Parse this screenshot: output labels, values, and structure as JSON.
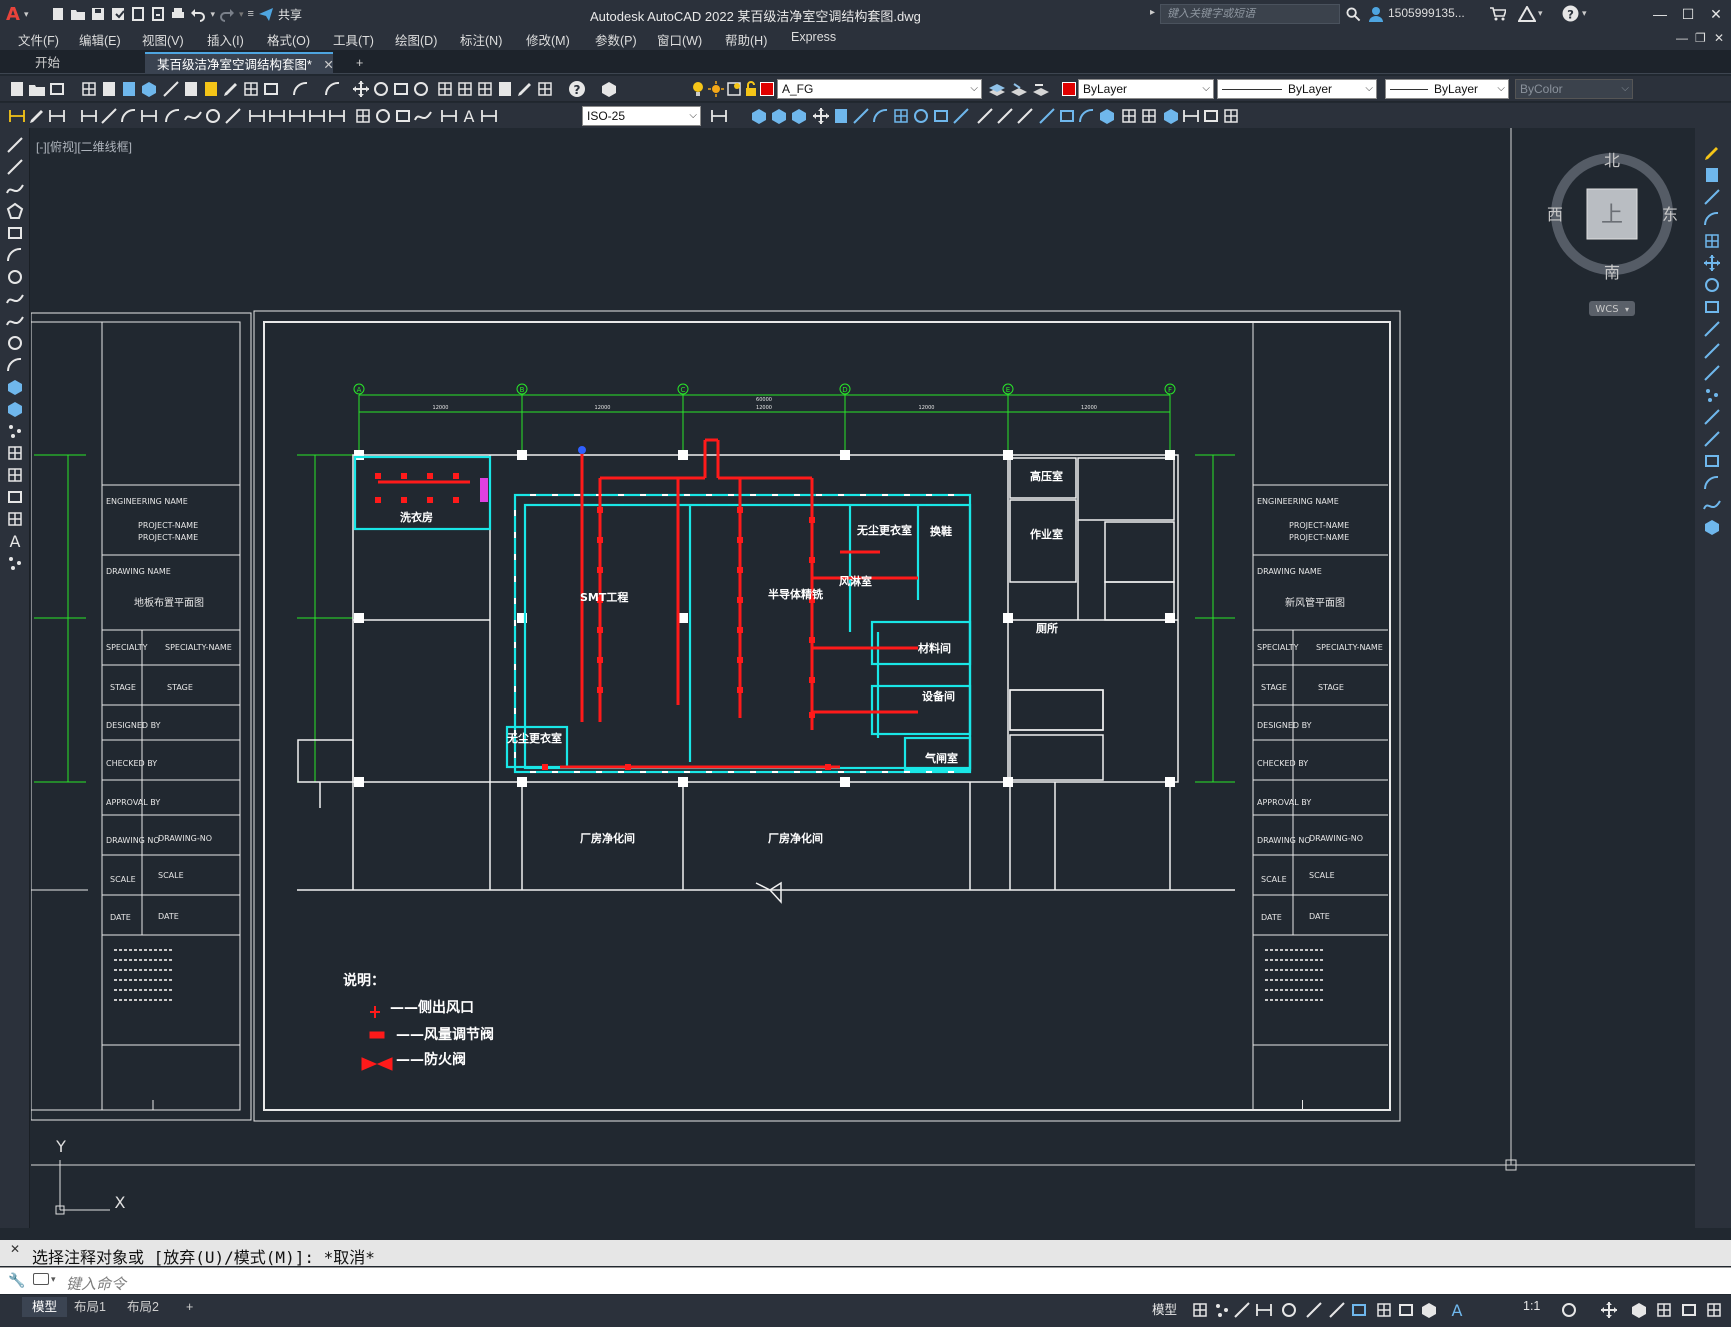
{
  "app": {
    "title": "Autodesk AutoCAD 2022    某百级洁净室空调结构套图.dwg",
    "search_placeholder": "键入关键字或短语",
    "user": "1505999135...",
    "share_label": "共享"
  },
  "menu": [
    "文件(F)",
    "编辑(E)",
    "视图(V)",
    "插入(I)",
    "格式(O)",
    "工具(T)",
    "绘图(D)",
    "标注(N)",
    "修改(M)",
    "参数(P)",
    "窗口(W)",
    "帮助(H)",
    "Express"
  ],
  "tabs": {
    "start": "开始",
    "doc": "某百级洁净室空调结构套图*",
    "add": "+"
  },
  "toolbar": {
    "layer": "A_FG",
    "color": "ByLayer",
    "linetype": "ByLayer",
    "lineweight": "ByLayer",
    "plotstyle": "ByColor",
    "dimstyle": "ISO-25"
  },
  "view_label": "[-][俯视][二维线框]",
  "viewcube": {
    "north": "北",
    "south": "南",
    "east": "东",
    "west": "西",
    "face": "上",
    "wcs": "WCS"
  },
  "drawing": {
    "grid_axes": [
      "A",
      "B",
      "C",
      "D",
      "E",
      "F"
    ],
    "total_dim": "60000",
    "bay_dim": "12000",
    "rooms": {
      "wash": "洗衣房",
      "smt": "SMT工程",
      "semi": "半导体精铣",
      "airlock": "无尘更衣室",
      "transfer": "换鞋",
      "high": "高压室",
      "prep": "作业室",
      "material": "材料间",
      "equipment": "设备间",
      "air_shower": "气闸室",
      "airlock2": "无尘更衣室",
      "shower": "风淋室",
      "corr1": "厂房净化间",
      "corr2": "厂房净化间",
      "toilet": "厕所"
    },
    "notes_title": "说明：",
    "legend": [
      "——侧出风口",
      "——风量调节阀",
      "——防火阀"
    ],
    "title_block_left": {
      "engineering": "ENGINEERING NAME",
      "project1": "PROJECT-NAME",
      "project2": "PROJECT-NAME",
      "drawing_name_label": "DRAWING NAME",
      "drawing_name": "地板布置平面图",
      "specialty": "SPECIALTY",
      "specialty_name": "SPECIALTY-NAME",
      "stage_label": "STAGE",
      "stage": "STAGE",
      "designed": "DESIGNED BY",
      "checked": "CHECKED BY",
      "approval": "APPROVAL BY",
      "drawing_no_label": "DRAWING NO",
      "drawing_no": "DRAWING-NO",
      "scale_label": "SCALE",
      "scale": "SCALE",
      "date_label": "DATE",
      "date": "DATE"
    },
    "title_block_right": {
      "engineering": "ENGINEERING NAME",
      "project1": "PROJECT-NAME",
      "project2": "PROJECT-NAME",
      "drawing_name_label": "DRAWING NAME",
      "drawing_name": "新风管平面图",
      "specialty": "SPECIALTY",
      "specialty_name": "SPECIALTY-NAME",
      "stage_label": "STAGE",
      "stage": "STAGE",
      "designed": "DESIGNED BY",
      "checked": "CHECKED BY",
      "approval": "APPROVAL BY",
      "drawing_no_label": "DRAWING NO",
      "drawing_no": "DRAWING-NO",
      "scale_label": "SCALE",
      "scale": "SCALE",
      "date_label": "DATE",
      "date": "DATE"
    },
    "ucs_x": "X",
    "ucs_y": "Y"
  },
  "command": {
    "history": "选择注释对象或 [放弃(U)/模式(M)]: *取消*",
    "placeholder": "键入命令"
  },
  "status": {
    "layout_tabs": [
      "模型",
      "布局1",
      "布局2"
    ],
    "model_label": "模型",
    "scale": "1:1"
  },
  "colors": {
    "accent_red": "#e8433b",
    "cyan_wall": "#19e6e6",
    "duct_red": "#ff1a1a",
    "grid_green": "#29e629"
  }
}
